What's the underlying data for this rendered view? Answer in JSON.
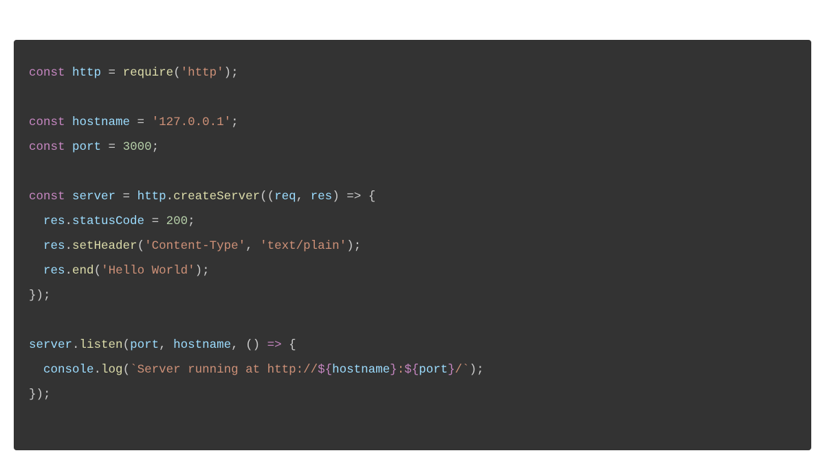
{
  "code": {
    "line1": {
      "keyword": "const",
      "var": "http",
      "assign": " = ",
      "func": "require",
      "open": "(",
      "str": "'http'",
      "close": ");"
    },
    "line3": {
      "keyword": "const",
      "var": "hostname",
      "assign": " = ",
      "str": "'127.0.0.1'",
      "end": ";"
    },
    "line4": {
      "keyword": "const",
      "var": "port",
      "assign": " = ",
      "num": "3000",
      "end": ";"
    },
    "line6": {
      "keyword": "const",
      "var": "server",
      "assign": " = ",
      "obj": "http",
      "dot": ".",
      "method": "createServer",
      "open": "((",
      "param1": "req",
      "comma": ", ",
      "param2": "res",
      "arrow": ") => {"
    },
    "line7": {
      "indent": "  ",
      "obj": "res",
      "dot": ".",
      "prop": "statusCode",
      "assign": " = ",
      "num": "200",
      "end": ";"
    },
    "line8": {
      "indent": "  ",
      "obj": "res",
      "dot": ".",
      "method": "setHeader",
      "open": "(",
      "str1": "'Content-Type'",
      "comma": ", ",
      "str2": "'text/plain'",
      "close": ");"
    },
    "line9": {
      "indent": "  ",
      "obj": "res",
      "dot": ".",
      "method": "end",
      "open": "(",
      "str": "'Hello World'",
      "close": ");"
    },
    "line10": {
      "close": "});"
    },
    "line12": {
      "obj": "server",
      "dot": ".",
      "method": "listen",
      "open": "(",
      "arg1": "port",
      "comma1": ", ",
      "arg2": "hostname",
      "comma2": ", () ",
      "arrow": "=>",
      "brace": " {"
    },
    "line13": {
      "indent": "  ",
      "obj": "console",
      "dot": ".",
      "method": "log",
      "open": "(",
      "tick1": "`",
      "str1": "Server running at http://",
      "interp1open": "${",
      "var1": "hostname",
      "interp1close": "}",
      "str2": ":",
      "interp2open": "${",
      "var2": "port",
      "interp2close": "}",
      "str3": "/",
      "tick2": "`",
      "close": ");"
    },
    "line14": {
      "close": "});"
    }
  }
}
